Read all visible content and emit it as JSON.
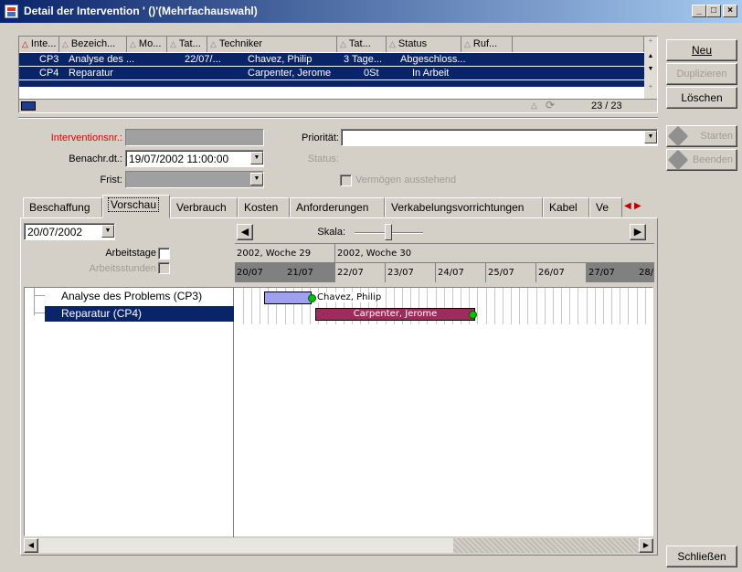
{
  "window": {
    "title": "Detail der Intervention ' ()'(Mehrfachauswahl)",
    "controls": {
      "minimize": "_",
      "maximize": "□",
      "close": "×"
    }
  },
  "list": {
    "columns": [
      "Inte...",
      "Bezeich...",
      "Mo...",
      "Tat...",
      "Techniker",
      "Tat...",
      "Status",
      "Ruf..."
    ],
    "rows": [
      {
        "num": "CP3",
        "bez": "Analyse des ...",
        "mo": "",
        "tat": "22/07/...",
        "tech": "Chavez, Philip",
        "tat2": "3 Tage...",
        "status": "Abgeschloss...",
        "ruf": ""
      },
      {
        "num": "CP4",
        "bez": "Reparatur",
        "mo": "",
        "tat": "",
        "tech": "Carpenter, Jerome",
        "tat2": "0St",
        "status": "In Arbeit",
        "ruf": ""
      }
    ],
    "counter": "23 / 23"
  },
  "buttons": {
    "neu": "Neu",
    "duplizieren": "Duplizieren",
    "loeschen": "Löschen",
    "starten": "Starten",
    "beenden": "Beenden",
    "schliessen": "Schließen"
  },
  "form": {
    "interventionsnr_label": "Interventionsnr.:",
    "interventionsnr_value": "",
    "benachr_label": "Benachr.dt.:",
    "benachr_value": "19/07/2002 11:00:00",
    "frist_label": "Frist:",
    "frist_value": "",
    "prioritaet_label": "Priorität:",
    "prioritaet_value": "",
    "status_label": "Status:",
    "vermoegen_label": "Vermögen ausstehend"
  },
  "tabs": [
    "Beschaffung",
    "Vorschau",
    "Verbrauch",
    "Kosten",
    "Anforderungen",
    "Verkabelungsvorrichtungen",
    "Kabel",
    "Ve"
  ],
  "active_tab": "Vorschau",
  "gantt": {
    "date": "20/07/2002",
    "skala_label": "Skala:",
    "arbeitstage_label": "Arbeitstage",
    "arbeitsstunden_label": "Arbeitsstunden",
    "weeks": [
      "2002, Woche 29",
      "2002, Woche 30"
    ],
    "days": [
      "20/07",
      "21/07",
      "22/07",
      "23/07",
      "24/07",
      "25/07",
      "26/07",
      "27/07",
      "28/"
    ],
    "tasks": [
      {
        "label": "Analyse des Problems (CP3)",
        "technician": "Chavez, Philip",
        "bar_color": "#a0a0f0"
      },
      {
        "label": "Reparatur (CP4)",
        "technician": "Carpenter, Jerome",
        "bar_color": "#9c2c5c"
      }
    ]
  },
  "colors": {
    "selection": "#0a246a",
    "required_label": "#e00000",
    "milestone": "#00c000"
  }
}
